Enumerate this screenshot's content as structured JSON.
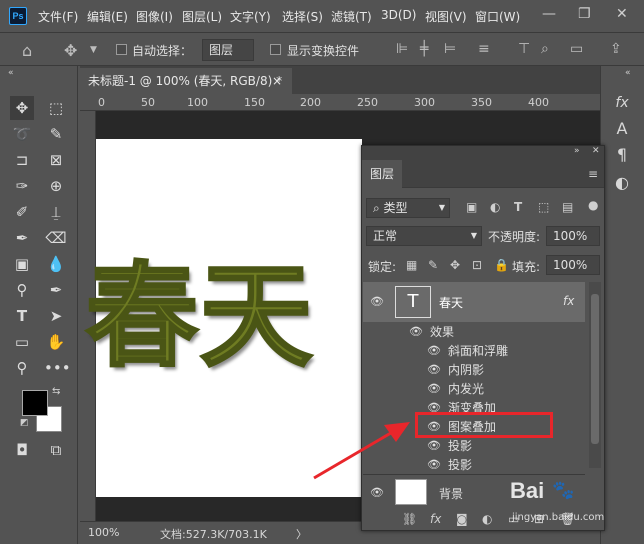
{
  "app": {
    "logo": "Ps"
  },
  "menu": [
    "文件(F)",
    "编辑(E)",
    "图像(I)",
    "图层(L)",
    "文字(Y)",
    "选择(S)",
    "滤镜(T)",
    "3D(D)",
    "视图(V)",
    "窗口(W)"
  ],
  "window_controls": {
    "minimize": "—",
    "restore": "❐",
    "close": "✕"
  },
  "options_bar": {
    "auto_select_label": "自动选择：",
    "auto_select_value": "图层",
    "show_transform_label": "显示变换控件"
  },
  "document": {
    "tab_title": "未标题-1 @ 100% (春天, RGB/8) *",
    "tab_close": "×",
    "canvas_text": "春天",
    "canvas_text_color": "#6f7c22"
  },
  "ruler": {
    "marks": [
      "0",
      "50",
      "100",
      "150",
      "200",
      "250",
      "300",
      "350",
      "400"
    ]
  },
  "status": {
    "zoom": "100%",
    "doc_size": "文档:527.3K/703.1K",
    "arrow": "〉"
  },
  "layers_panel": {
    "tab": "图层",
    "filter_label": "类型",
    "blend_mode": "正常",
    "opacity_label": "不透明度:",
    "opacity_value": "100%",
    "lock_label": "锁定:",
    "fill_label": "填充:",
    "fill_value": "100%",
    "layers": [
      {
        "name": "春天",
        "thumb": "T",
        "fx": "fx"
      },
      {
        "name": "背景"
      }
    ],
    "effects_header": "效果",
    "effects": [
      "斜面和浮雕",
      "内阴影",
      "内发光",
      "渐变叠加",
      "图案叠加",
      "投影",
      "投影"
    ],
    "highlighted_effect": "图案叠加",
    "bottom_fx": "fx"
  },
  "watermark": {
    "text": "Bai",
    "sub": "jingyan.baidu.com"
  },
  "colors": {
    "highlight": "#e8262b",
    "accent": "#31a8ff"
  }
}
